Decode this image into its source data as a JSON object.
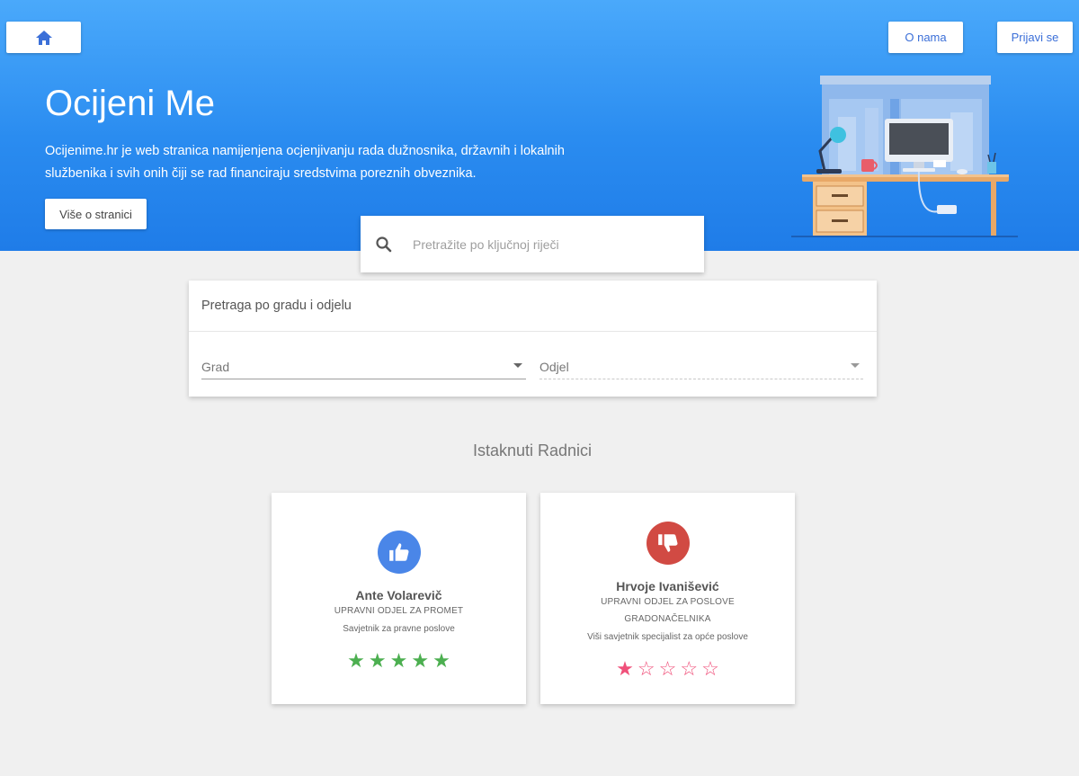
{
  "nav": {
    "home_icon": "home-icon",
    "about_label": "O nama",
    "login_label": "Prijavi se"
  },
  "hero": {
    "title": "Ocijeni Me",
    "description": "Ocijenime.hr je web stranica namijenjena ocjenjivanju rada dužnosnika, državnih i lokalnih službenika i svih onih čiji se rad financiraju sredstvima poreznih obveznika.",
    "more_button": "Više o stranici"
  },
  "search": {
    "placeholder": "Pretražite po ključnoj riječi",
    "icon": "search-icon"
  },
  "filter": {
    "title": "Pretraga po gradu i odjelu",
    "city_label": "Grad",
    "department_label": "Odjel"
  },
  "featured": {
    "title": "Istaknuti Radnici",
    "employees": [
      {
        "name": "Ante Volarevič",
        "department": "UPRAVNI ODJEL ZA PROMET",
        "role": "Savjetnik za pravne poslove",
        "icon": "thumbs-up-icon",
        "icon_color": "#4a86e8",
        "rating": 5,
        "star_color": "#4caf50"
      },
      {
        "name": "Hrvoje Ivanišević",
        "department": "UPRAVNI ODJEL ZA POSLOVE GRADONAČELNIKA",
        "role": "Viši savjetnik specijalist za opće poslove",
        "icon": "thumbs-down-icon",
        "icon_color": "#d14a43",
        "rating": 1,
        "star_color": "#f0507a"
      }
    ]
  },
  "colors": {
    "hero_gradient_top": "#4aa9fb",
    "hero_gradient_bottom": "#1f7ce8",
    "background": "#f0f0f0",
    "link_blue": "#3b6fd8"
  }
}
